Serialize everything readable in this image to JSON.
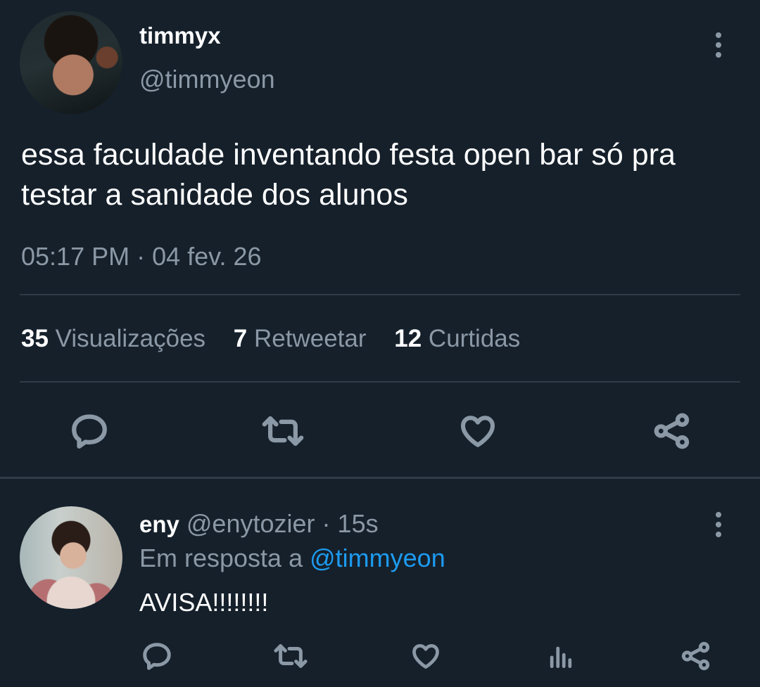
{
  "tweet": {
    "display_name": "timmyx",
    "handle": "@timmyeon",
    "text": "essa faculdade inventando festa open bar só pra testar a sanidade dos alunos",
    "timestamp": "05:17 PM · 04 fev. 26",
    "stats": {
      "views_count": "35",
      "views_label": "Visualizações",
      "retweets_count": "7",
      "retweets_label": "Retweetar",
      "likes_count": "12",
      "likes_label": "Curtidas"
    },
    "actions": [
      "reply-icon",
      "retweet-icon",
      "like-icon",
      "share-icon"
    ]
  },
  "reply": {
    "display_name": "eny",
    "handle": "@enytozier",
    "separator": "·",
    "time_ago": "15s",
    "in_reply_to_label": "Em resposta a",
    "in_reply_to_handle": "@timmyeon",
    "text": "AVISA!!!!!!!!",
    "actions": [
      "reply-icon",
      "retweet-icon",
      "like-icon",
      "analytics-icon",
      "share-icon"
    ]
  },
  "colors": {
    "background": "#15202b",
    "text": "#ffffff",
    "secondary": "#8b98a5",
    "link": "#1d9bf0",
    "divider": "#2f3b47"
  }
}
